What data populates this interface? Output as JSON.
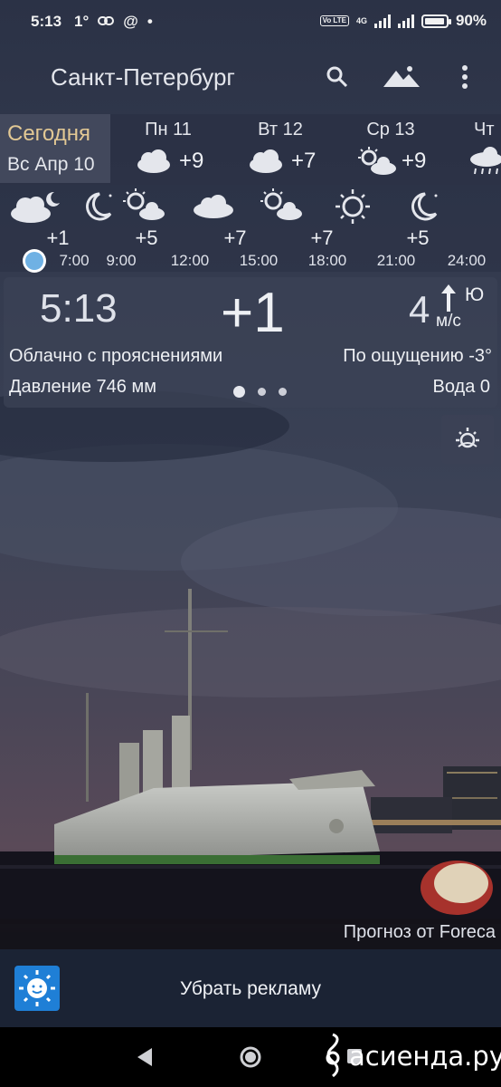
{
  "status_bar": {
    "time": "5:13",
    "temp_indicator": "1°",
    "left_icons": [
      "link-icon",
      "at-icon",
      "dot-icon"
    ],
    "network": "4G",
    "volte": "Vo LTE",
    "battery": "90%",
    "battery_level": 0.9
  },
  "header": {
    "city": "Санкт-Петербург",
    "icons": [
      "search-icon",
      "mountains-icon",
      "more-vert-icon"
    ]
  },
  "days": {
    "today": {
      "label": "Сегодня",
      "date": "Вс Апр 10"
    },
    "items": [
      {
        "name": "Пн 11",
        "icon": "partly-cloudy-icon",
        "temp": "+9"
      },
      {
        "name": "Вт 12",
        "icon": "cloudy-icon",
        "temp": "+7"
      },
      {
        "name": "Ср 13",
        "icon": "partly-sunny-icon",
        "temp": "+9"
      },
      {
        "name": "Чт",
        "icon": "rain-icon",
        "temp": ""
      }
    ]
  },
  "hourly": [
    {
      "time": "7:00",
      "temp": "+1",
      "icon": "cloudy-night-icon"
    },
    {
      "time": "9:00",
      "temp": "",
      "icon": "moon-icon"
    },
    {
      "time": "12:00",
      "temp": "+5",
      "icon": "partly-sunny-icon"
    },
    {
      "time": "15:00",
      "temp": "",
      "icon": "cloudy-icon"
    },
    {
      "time": "18:00",
      "temp": "+7",
      "icon": "partly-sunny-icon"
    },
    {
      "time": "21:00",
      "temp": "+7",
      "icon": "sun-icon"
    },
    {
      "time": "24:00",
      "temp": "+5",
      "icon": "moon-icon"
    }
  ],
  "current": {
    "time": "5:13",
    "temp": "+1",
    "wind_speed": "4",
    "wind_dir": "Ю",
    "wind_unit": "м/с",
    "condition": "Облачно с прояснениями",
    "feels_like": "По ощущению -3°",
    "pressure": "Давление 746 мм",
    "water": "Вода 0",
    "page_dots": 3
  },
  "credit": "Прогноз от Foreca",
  "ad_bar": {
    "text": "Убрать рекламу"
  },
  "navbar": {
    "icons": [
      "back-icon",
      "home-icon",
      "recent-apps-icon"
    ]
  },
  "watermark": "асиенда.ру"
}
